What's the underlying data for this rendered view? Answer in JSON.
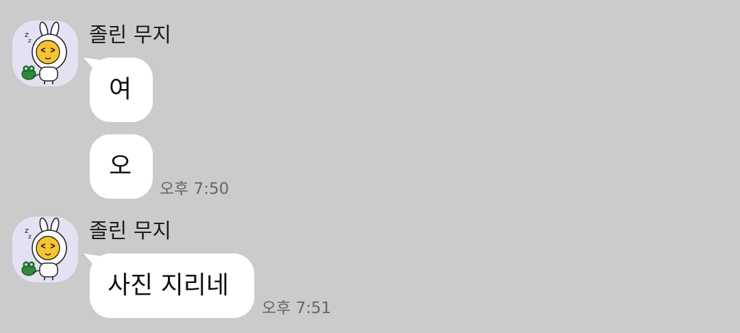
{
  "chat": {
    "groups": [
      {
        "sender": "졸린 무지",
        "avatar_icon": "muzi-sleepy-avatar-icon",
        "messages": [
          {
            "text": "여"
          },
          {
            "text": "오",
            "time": "오후 7:50"
          }
        ]
      },
      {
        "sender": "졸린 무지",
        "avatar_icon": "muzi-sleepy-avatar-icon",
        "messages": [
          {
            "text": "사진 지리네",
            "time": "오후 7:51"
          }
        ]
      }
    ]
  },
  "colors": {
    "background": "#cbcbcb",
    "bubble": "#ffffff",
    "avatar_bg": "#e4e2f2",
    "character_yellow": "#f6c431",
    "crocodile_green": "#2f8b3a"
  }
}
